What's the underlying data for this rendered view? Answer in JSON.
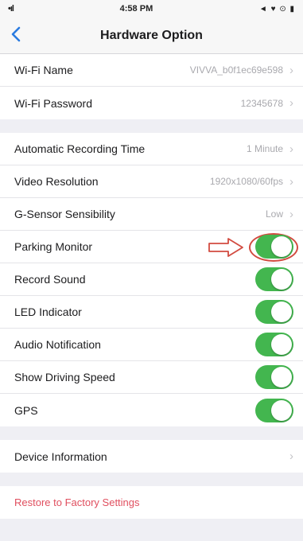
{
  "status_bar": {
    "signal": "•ıl",
    "time": "4:58 PM",
    "right_icons": "◄ ♥ ⊙ ▮"
  },
  "nav": {
    "back_icon": "chevron-left-icon",
    "title": "Hardware Option"
  },
  "wifi_group": [
    {
      "label": "Wi-Fi Name",
      "value": "VIVVA_b0f1ec69e598"
    },
    {
      "label": "Wi-Fi Password",
      "value": "12345678"
    }
  ],
  "settings_group": [
    {
      "label": "Automatic Recording Time",
      "value": "1 Minute"
    },
    {
      "label": "Video Resolution",
      "value": "1920x1080/60fps"
    },
    {
      "label": "G-Sensor Sensibility",
      "value": "Low"
    }
  ],
  "toggles": [
    {
      "label": "Parking Monitor",
      "on": true,
      "highlighted": true
    },
    {
      "label": "Record Sound",
      "on": true
    },
    {
      "label": "LED Indicator",
      "on": true
    },
    {
      "label": "Audio Notification",
      "on": true
    },
    {
      "label": "Show Driving Speed",
      "on": true
    },
    {
      "label": "GPS",
      "on": true
    }
  ],
  "device_info": {
    "label": "Device Information"
  },
  "factory": {
    "label": "Restore to Factory Settings"
  },
  "colors": {
    "toggle_on": "#43b64f",
    "accent": "#2a7be0",
    "annotation": "#d24b40",
    "danger": "#e04f5f"
  }
}
